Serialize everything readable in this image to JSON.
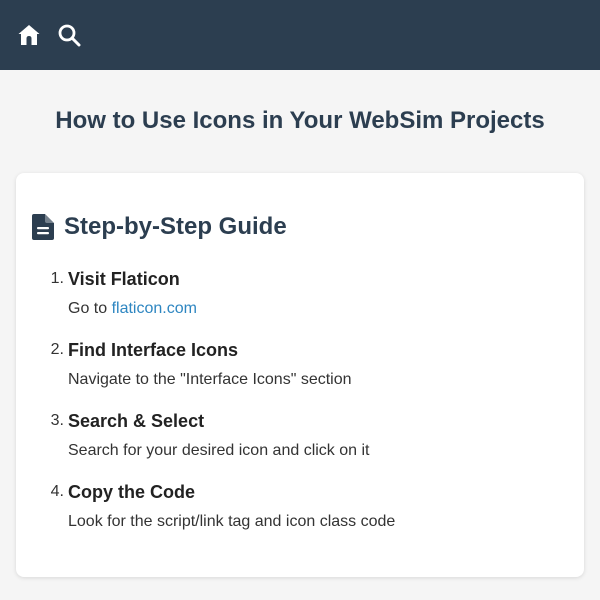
{
  "header": {
    "home_icon": "home-icon",
    "search_icon": "search-icon",
    "bg_color": "#2c3e50"
  },
  "page": {
    "title": "How to Use Icons in Your WebSim Projects"
  },
  "guide": {
    "icon": "document-icon",
    "title": "Step-by-Step Guide",
    "steps": [
      {
        "number": "1.",
        "title": "Visit Flaticon",
        "desc_prefix": "Go to ",
        "link_text": "flaticon.com"
      },
      {
        "number": "2.",
        "title": "Find Interface Icons",
        "desc": "Navigate to the \"Interface Icons\" section"
      },
      {
        "number": "3.",
        "title": "Search & Select",
        "desc": "Search for your desired icon and click on it"
      },
      {
        "number": "4.",
        "title": "Copy the Code",
        "desc": "Look for the script/link tag and icon class code"
      }
    ]
  },
  "colors": {
    "accent": "#2c3e50",
    "link": "#2e86c1",
    "background": "#f5f5f5",
    "card": "#ffffff"
  }
}
